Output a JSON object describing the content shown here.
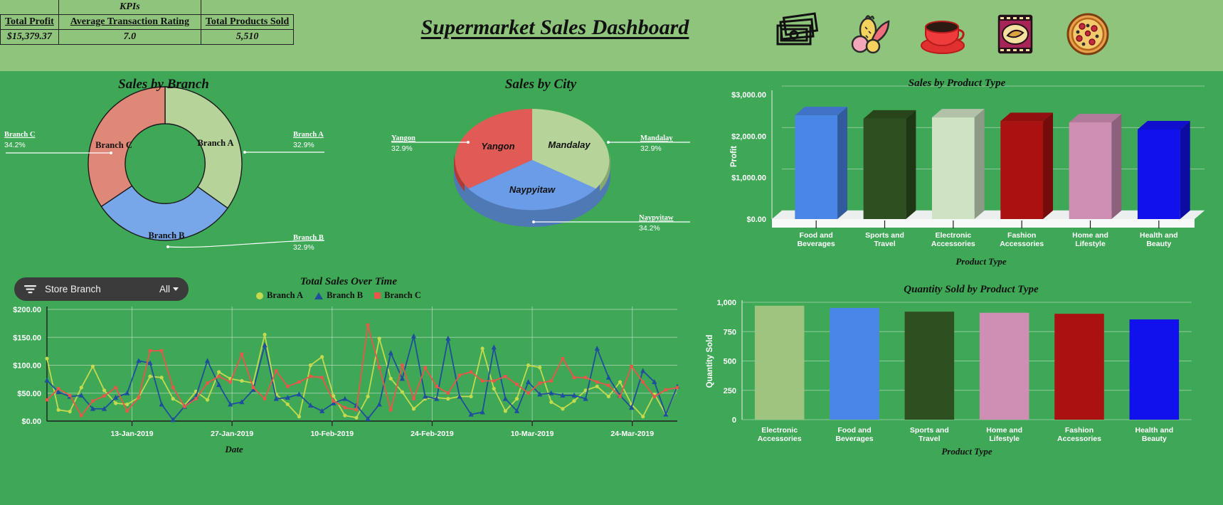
{
  "header": {
    "dashboard_title": "Supermarket Sales Dashboard",
    "kpi_group_label": "KPIs",
    "kpi_headers": [
      "Total Profit",
      "Average Transaction Rating",
      "Total Products Sold"
    ],
    "kpi_values": [
      "$15,379.37",
      "7.0",
      "5,510"
    ],
    "icons": [
      "cash-money-icon",
      "fruits-icon",
      "coffee-cup-icon",
      "snack-bag-icon",
      "pizza-icon"
    ]
  },
  "colors": {
    "page_bg": "#3fa856",
    "header_bg": "#8fc47c",
    "branch_a": "#b6d49a",
    "branch_b": "#77a7e8",
    "branch_c": "#e08878",
    "city_yangon": "#e05b56",
    "city_mandalay": "#b6d49a",
    "city_naypyitaw": "#6b9ce8",
    "line_a": "#c3d94e",
    "line_b": "#1f4e9c",
    "line_c": "#e8574a",
    "filter_bg": "#3b3b3b"
  },
  "donut": {
    "title": "Sales by Branch",
    "labels_left": {
      "name": "Branch C",
      "pct": "34.2%"
    },
    "labels_right_top": {
      "name": "Branch A",
      "pct": "32.9%"
    },
    "labels_right_bottom": {
      "name": "Branch B",
      "pct": "32.9%"
    },
    "inner_labels": [
      "Branch C",
      "Branch A",
      "Branch B"
    ]
  },
  "pie": {
    "title": "Sales by City",
    "labels_left": {
      "name": "Yangon",
      "pct": "32.9%"
    },
    "labels_right_top": {
      "name": "Mandalay",
      "pct": "32.9%"
    },
    "labels_right_bottom": {
      "name": "Naypyitaw",
      "pct": "34.2%"
    },
    "inner_labels": [
      "Yangon",
      "Mandalay",
      "Naypyitaw"
    ]
  },
  "line_chart_filter": {
    "icon": "filter-icon",
    "label": "Store Branch",
    "value": "All"
  },
  "line_legend": [
    {
      "label": "Branch A",
      "marker": "circle"
    },
    {
      "label": "Branch B",
      "marker": "triangle"
    },
    {
      "label": "Branch C",
      "marker": "square"
    }
  ],
  "chart_data": [
    {
      "type": "pie",
      "title": "Sales by Branch",
      "variant": "donut",
      "categories": [
        "Branch A",
        "Branch B",
        "Branch C"
      ],
      "values": [
        32.9,
        32.9,
        34.2
      ],
      "value_suffix": "%",
      "colors": [
        "#b6d49a",
        "#77a7e8",
        "#e08878"
      ],
      "legend": "callouts"
    },
    {
      "type": "pie",
      "title": "Sales by City",
      "variant": "3d-pie",
      "categories": [
        "Yangon",
        "Mandalay",
        "Naypyitaw"
      ],
      "values": [
        32.9,
        32.9,
        34.2
      ],
      "value_suffix": "%",
      "colors": [
        "#e05b56",
        "#b6d49a",
        "#6b9ce8"
      ],
      "legend": "callouts"
    },
    {
      "type": "bar",
      "title": "Sales by Product Type",
      "variant": "3d-column",
      "xlabel": "Product Type",
      "ylabel": "Profit",
      "categories": [
        "Food and Beverages",
        "Sports and Travel",
        "Electronic Accessories",
        "Fashion Accessories",
        "Home and Lifestyle",
        "Health and Beauty"
      ],
      "values": [
        2500,
        2420,
        2450,
        2360,
        2330,
        2160
      ],
      "colors": [
        "#4a86e8",
        "#2e4f1f",
        "#cfe2c4",
        "#aa1111",
        "#cf8fb5",
        "#1111ee"
      ],
      "ylim": [
        0,
        3000
      ],
      "yticks": [
        0,
        1000,
        2000,
        3000
      ],
      "ytick_labels": [
        "$0.00",
        "$1,000.00",
        "$2,000.00",
        "$3,000.00"
      ],
      "grid": true
    },
    {
      "type": "bar",
      "title": "Quantity Sold by Product Type",
      "variant": "column",
      "xlabel": "Product Type",
      "ylabel": "Quantity Sold",
      "categories": [
        "Electronic Accessories",
        "Food and Beverages",
        "Sports and Travel",
        "Home and Lifestyle",
        "Fashion Accessories",
        "Health and Beauty"
      ],
      "values": [
        971,
        952,
        920,
        911,
        902,
        854
      ],
      "colors": [
        "#9fc47f",
        "#4a86e8",
        "#2e4f1f",
        "#cf8fb5",
        "#aa1111",
        "#1111ee"
      ],
      "ylim": [
        0,
        1000
      ],
      "yticks": [
        0,
        250,
        500,
        750,
        1000
      ],
      "ytick_labels": [
        "0",
        "250",
        "500",
        "750",
        "1,000"
      ],
      "grid": true
    },
    {
      "type": "line",
      "title": "Total Sales Over Time",
      "xlabel": "Date",
      "ylabel": "",
      "ylim": [
        0,
        200
      ],
      "yticks": [
        0,
        50,
        100,
        150,
        200
      ],
      "ytick_labels": [
        "$0.00",
        "$50.00",
        "$100.00",
        "$150.00",
        "$200.00"
      ],
      "xtick_labels": [
        "13-Jan-2019",
        "27-Jan-2019",
        "10-Feb-2019",
        "24-Feb-2019",
        "10-Mar-2019",
        "24-Mar-2019"
      ],
      "grid": true,
      "series": [
        {
          "name": "Branch A",
          "color": "#c3d94e",
          "marker": "circle",
          "values": [
            112,
            20,
            17,
            60,
            98,
            55,
            32,
            30,
            42,
            80,
            78,
            40,
            28,
            53,
            38,
            88,
            76,
            72,
            68,
            155,
            48,
            30,
            8,
            100,
            115,
            45,
            10,
            6,
            44,
            148,
            76,
            52,
            22,
            40,
            42,
            40,
            44,
            44,
            130,
            58,
            18,
            40,
            100,
            96,
            34,
            22,
            36,
            55,
            62,
            44,
            70,
            30,
            8,
            48,
            12,
            60
          ]
        },
        {
          "name": "Branch B",
          "color": "#1f4e9c",
          "marker": "triangle",
          "values": [
            73,
            52,
            44,
            46,
            22,
            22,
            42,
            50,
            108,
            104,
            30,
            2,
            26,
            44,
            108,
            65,
            30,
            34,
            56,
            136,
            40,
            42,
            48,
            28,
            18,
            32,
            40,
            28,
            4,
            30,
            122,
            76,
            152,
            44,
            40,
            148,
            44,
            12,
            16,
            132,
            40,
            18,
            70,
            48,
            50,
            46,
            46,
            40,
            130,
            78,
            46,
            24,
            90,
            70,
            12,
            62
          ]
        },
        {
          "name": "Branch C",
          "color": "#e8574a",
          "marker": "square",
          "values": [
            38,
            58,
            46,
            10,
            36,
            45,
            60,
            18,
            42,
            126,
            126,
            60,
            26,
            40,
            68,
            80,
            70,
            120,
            60,
            40,
            90,
            62,
            70,
            80,
            78,
            36,
            24,
            20,
            172,
            96,
            20,
            100,
            40,
            96,
            62,
            50,
            82,
            88,
            72,
            72,
            80,
            66,
            50,
            68,
            72,
            112,
            78,
            78,
            70,
            64,
            44,
            98,
            70,
            44,
            56,
            60
          ]
        }
      ]
    }
  ]
}
